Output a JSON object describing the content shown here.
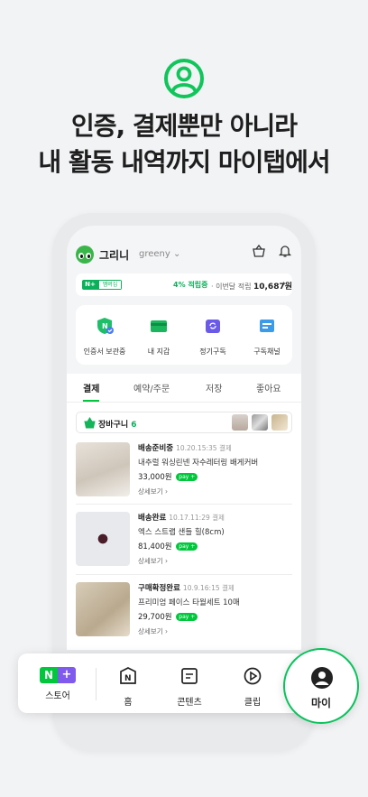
{
  "headline": {
    "line1": "인증, 결제뿐만 아니라",
    "line2": "내 활동 내역까지 마이탭에서"
  },
  "profile": {
    "name": "그리니",
    "id": "greeny"
  },
  "membership": {
    "badge_n": "N+",
    "badge_label": "멤버십",
    "rate": "4% 적립중",
    "points_prefix": "· 이번달 적립",
    "points": "10,687원"
  },
  "quick": [
    {
      "label": "인증서 보관중",
      "icon": "certificate-icon"
    },
    {
      "label": "내 지갑",
      "icon": "wallet-icon"
    },
    {
      "label": "정기구독",
      "icon": "subscription-icon"
    },
    {
      "label": "구독채널",
      "icon": "channel-icon"
    }
  ],
  "tabs": [
    "결제",
    "예약/주문",
    "저장",
    "좋아요"
  ],
  "active_tab": "결제",
  "cart": {
    "label": "장바구니",
    "count": "6"
  },
  "orders": [
    {
      "status": "배송준비중",
      "date": "10.20.15:35 결제",
      "name": "내추럴 워싱린넨 자수레터링 배게커버",
      "price": "33,000원",
      "pay": "pay +",
      "detail": "상세보기 ›"
    },
    {
      "status": "배송완료",
      "date": "10.17.11:29 결제",
      "name": "엑스 스트랩 샌들 힐(8cm)",
      "price": "81,400원",
      "pay": "pay +",
      "detail": "상세보기 ›"
    },
    {
      "status": "구매확정완료",
      "date": "10.9.16:15 결제",
      "name": "프리미엄 페이스 타월세트 10매",
      "price": "29,700원",
      "pay": "pay +",
      "detail": "상세보기 ›"
    }
  ],
  "nav": {
    "store": "스토어",
    "store_n": "N",
    "store_plus": "+",
    "home": "홈",
    "content": "콘텐츠",
    "clip": "클립",
    "my": "마이"
  },
  "colors": {
    "green": "#00c73c",
    "purple": "#7f5aed",
    "bg": "#f2f3f5"
  }
}
